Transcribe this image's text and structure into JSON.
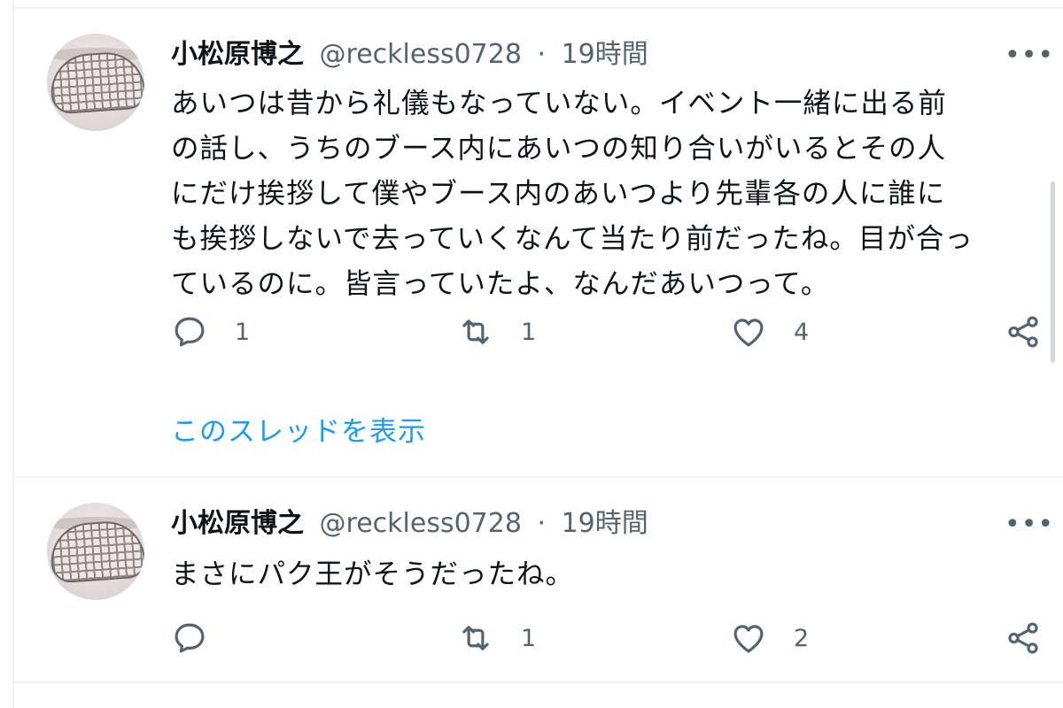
{
  "tweets": [
    {
      "display_name": "小松原博之",
      "handle": "@reckless0728",
      "separator": "·",
      "time": "19時間",
      "more_icon": "more-dots-icon",
      "lines": [
        "あいつは昔から礼儀もなっていない。イベント一緒に出る前",
        "の話し、うちのブース内にあいつの知り合いがいるとその人",
        "にだけ挨拶して僕やブース内のあいつより先輩各の人に誰に",
        "も挨拶しないで去っていくなんて当たり前だったね。目が合っ",
        "ているのに。皆言っていたよ、なんだあいつって。"
      ],
      "reply_count": "1",
      "retweet_count": "1",
      "like_count": "4",
      "show_thread": "このスレッドを表示"
    },
    {
      "display_name": "小松原博之",
      "handle": "@reckless0728",
      "separator": "·",
      "time": "19時間",
      "more_icon": "more-dots-icon",
      "lines": [
        "まさにパク王がそうだったね。"
      ],
      "reply_count": "",
      "retweet_count": "1",
      "like_count": "2"
    }
  ],
  "icons": {
    "reply": "reply-icon",
    "retweet": "retweet-icon",
    "like": "heart-icon",
    "share": "share-icon"
  },
  "colors": {
    "text": "#0f1419",
    "secondary": "#536471",
    "link": "#1d9bf0",
    "divider": "#eff3f4"
  }
}
